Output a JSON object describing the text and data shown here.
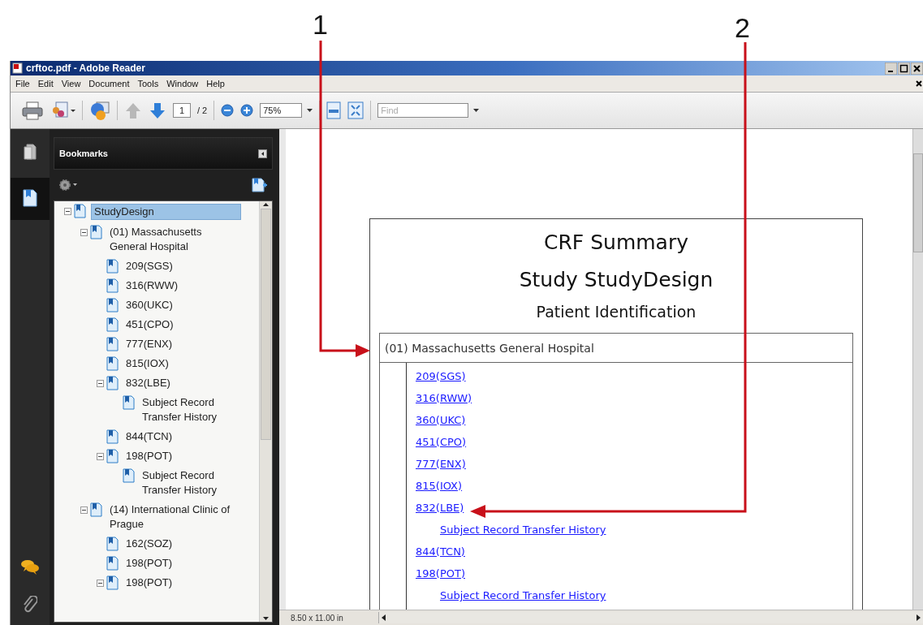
{
  "callouts": [
    {
      "label": "1"
    },
    {
      "label": "2"
    }
  ],
  "window": {
    "title": "crftoc.pdf - Adobe Reader"
  },
  "menu": [
    "File",
    "Edit",
    "View",
    "Document",
    "Tools",
    "Window",
    "Help"
  ],
  "toolbar": {
    "previous_page": {
      "disabled": true
    },
    "next_page": {
      "disabled": false
    },
    "page": "1",
    "page_count": "/ 2",
    "zoom": "75%",
    "find": {
      "placeholder": "Find"
    }
  },
  "bookmarks": {
    "title": "Bookmarks",
    "tree": [
      {
        "label": "StudyDesign",
        "selected": true,
        "expanded": true,
        "children": [
          {
            "label": "(01) Massachusetts General Hospital",
            "selected": false,
            "expanded": true,
            "children": [
              {
                "label": "209(SGS)",
                "selected": false
              },
              {
                "label": "316(RWW)",
                "selected": false
              },
              {
                "label": "360(UKC)",
                "selected": false
              },
              {
                "label": "451(CPO)",
                "selected": false
              },
              {
                "label": "777(ENX)",
                "selected": false
              },
              {
                "label": "815(IOX)",
                "selected": false
              },
              {
                "label": "832(LBE)",
                "selected": false,
                "expanded": true,
                "children": [
                  {
                    "label": "Subject Record Transfer History",
                    "selected": false
                  }
                ]
              },
              {
                "label": "844(TCN)",
                "selected": false
              },
              {
                "label": "198(POT)",
                "selected": false,
                "expanded": true,
                "children": [
                  {
                    "label": "Subject Record Transfer History",
                    "selected": false
                  }
                ]
              }
            ]
          },
          {
            "label": "(14) International Clinic of Prague",
            "selected": false,
            "expanded": true,
            "children": [
              {
                "label": "162(SOZ)",
                "selected": false
              },
              {
                "label": "198(POT)",
                "selected": false
              },
              {
                "label": "198(POT)",
                "selected": false,
                "expanded": true
              }
            ]
          }
        ]
      }
    ]
  },
  "document": {
    "title": "CRF Summary",
    "subtitle": "Study StudyDesign",
    "heading": "Patient Identification",
    "site": "(01) Massachusetts General Hospital",
    "links": [
      {
        "label": "209(SGS)"
      },
      {
        "label": "316(RWW)"
      },
      {
        "label": "360(UKC)"
      },
      {
        "label": "451(CPO)"
      },
      {
        "label": "777(ENX)"
      },
      {
        "label": "815(IOX)"
      },
      {
        "label": "832(LBE)",
        "children": [
          {
            "label": "Subject Record Transfer History"
          }
        ]
      },
      {
        "label": "844(TCN)"
      },
      {
        "label": "198(POT)",
        "children": [
          {
            "label": "Subject Record Transfer History"
          }
        ]
      }
    ]
  },
  "status_bar": {
    "page_size": "8.50 x 11.00 in"
  }
}
